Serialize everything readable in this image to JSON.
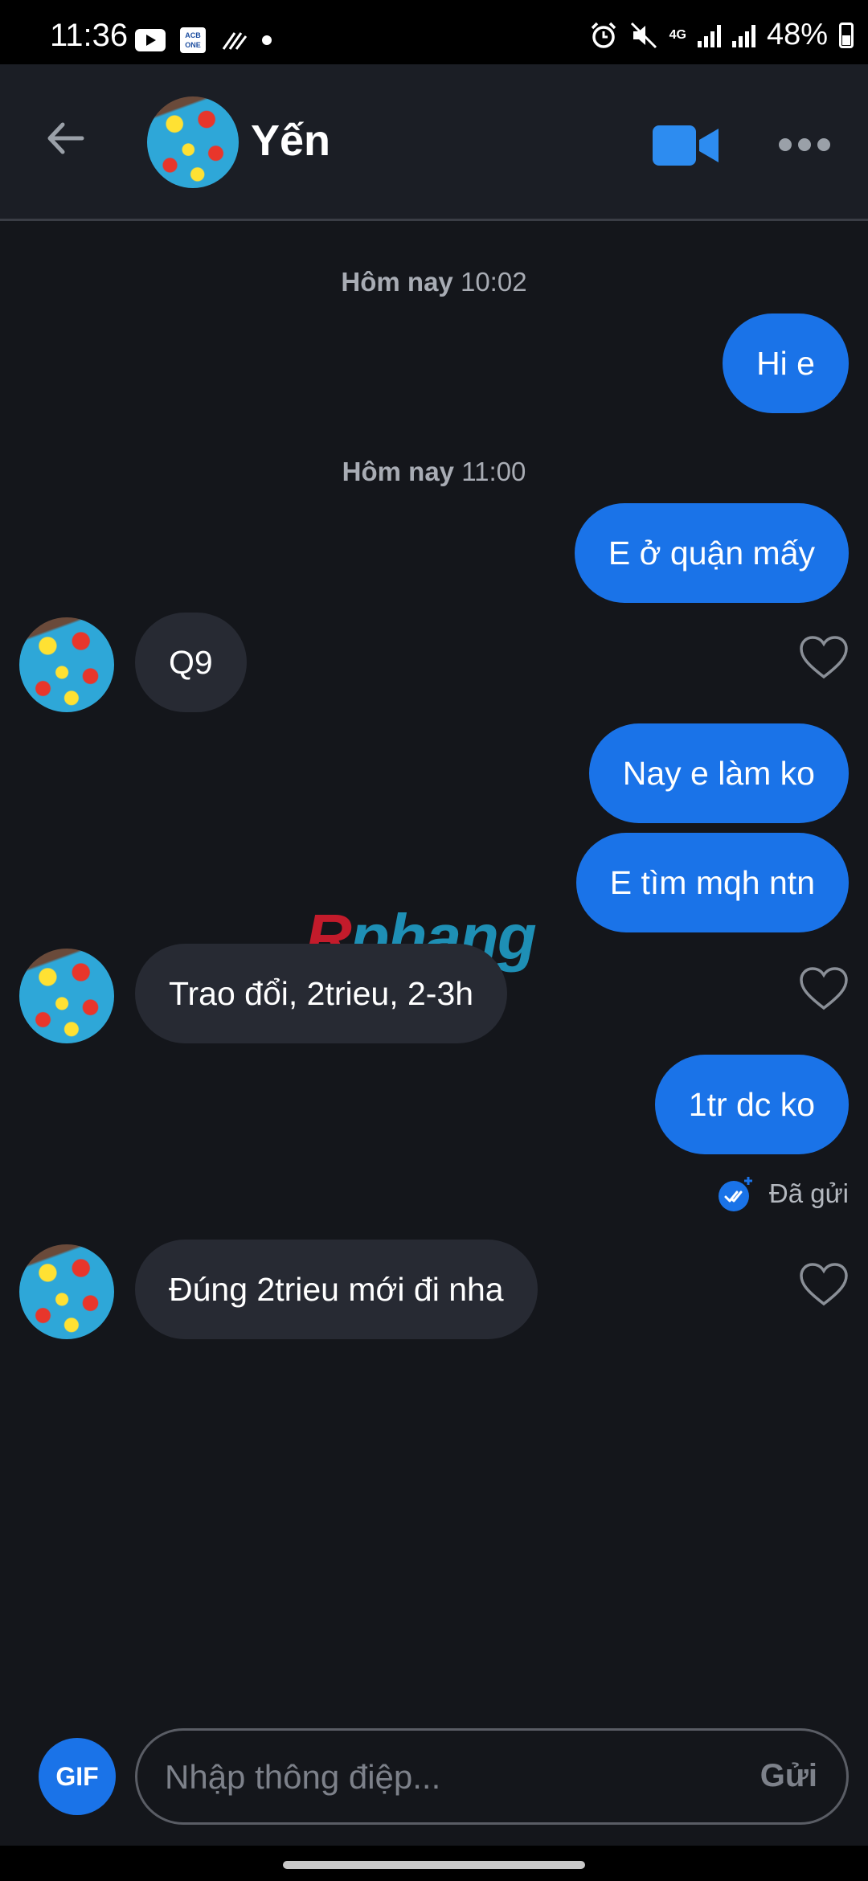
{
  "status_bar": {
    "time": "11:36",
    "network": "4G",
    "battery": "48%",
    "acb_label": "ACB ONE",
    "icons": [
      "youtube-icon",
      "acb-one-icon",
      "stripes-icon",
      "dot-icon",
      "alarm-icon",
      "mute-icon",
      "signal-icon",
      "battery-icon"
    ]
  },
  "header": {
    "contact_name": "Yến",
    "back_icon": "arrow-left-icon",
    "video_icon": "video-camera-icon",
    "more_icon": "more-horizontal-icon",
    "accent": "#2d8cf0"
  },
  "messages": {
    "ts1_day": "Hôm nay",
    "ts1_time": "10:02",
    "m1": "Hi e",
    "ts2_day": "Hôm nay",
    "ts2_time": "11:00",
    "m2": "E ở quận mấy",
    "m3": "Q9",
    "m4": "Nay e làm ko",
    "m5": "E tìm mqh ntn",
    "m6": "Trao đổi, 2trieu, 2-3h",
    "m7": "1tr dc ko",
    "status": "Đã gửi",
    "m8": "Đúng 2trieu mới đi nha"
  },
  "watermark": {
    "part1": "R",
    "part2": "phang"
  },
  "composer": {
    "gif_label": "GIF",
    "placeholder": "Nhập thông điệp...",
    "send_label": "Gửi"
  },
  "colors": {
    "background": "#14161b",
    "outgoing": "#1a73e8",
    "incoming": "#272a33"
  }
}
